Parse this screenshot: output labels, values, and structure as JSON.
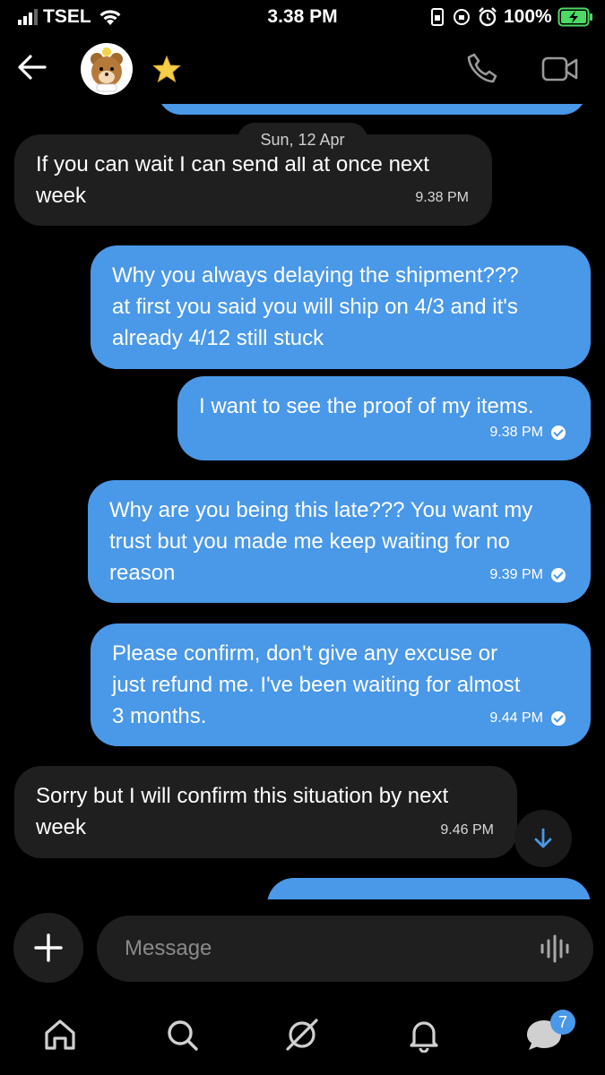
{
  "status_bar": {
    "carrier": "TSEL",
    "time": "3.38 PM",
    "battery_percent": "100%",
    "icons": [
      "signal-icon",
      "wifi-icon",
      "portrait-lock-icon",
      "orientation-lock-icon",
      "alarm-icon",
      "battery-charging-icon"
    ]
  },
  "header": {
    "icons": [
      "back-arrow-icon",
      "avatar",
      "star-icon",
      "phone-call-icon",
      "video-call-icon"
    ]
  },
  "conversation": {
    "date_separator": "Sun, 12 Apr",
    "messages": [
      {
        "direction": "incoming",
        "text": "If you can wait I can send all at once next\nweek",
        "time": "9.38 PM"
      },
      {
        "direction": "outgoing",
        "text": "Why you always delaying the shipment???\nat first you said you will ship on 4/3 and it's\nalready 4/12 still stuck",
        "time": ""
      },
      {
        "direction": "outgoing",
        "text": "I want to see the proof of my items.",
        "time": "9.38 PM",
        "read": true
      },
      {
        "direction": "outgoing",
        "text": "Why are you being this late??? You want my\ntrust but you made me keep waiting for no\nreason",
        "time": "9.39 PM",
        "read": true
      },
      {
        "direction": "outgoing",
        "text": "Please confirm, don't give any excuse or\njust refund me. I've been waiting for almost\n3 months.",
        "time": "9.44 PM",
        "read": true
      },
      {
        "direction": "incoming",
        "text": "Sorry but I will confirm this situation by next\nweek",
        "time": "9.46 PM"
      }
    ]
  },
  "composer": {
    "placeholder": "Message",
    "icons": [
      "plus-icon",
      "voice-wave-icon"
    ]
  },
  "bottom_nav": {
    "items": [
      "home-icon",
      "search-icon",
      "explore-icon",
      "notifications-icon",
      "chat-icon"
    ],
    "chat_badge": "7"
  },
  "colors": {
    "outgoing_bubble": "#4a98e8",
    "incoming_bubble": "#1f1f1f",
    "background": "#000000",
    "accent": "#4a98e8"
  }
}
